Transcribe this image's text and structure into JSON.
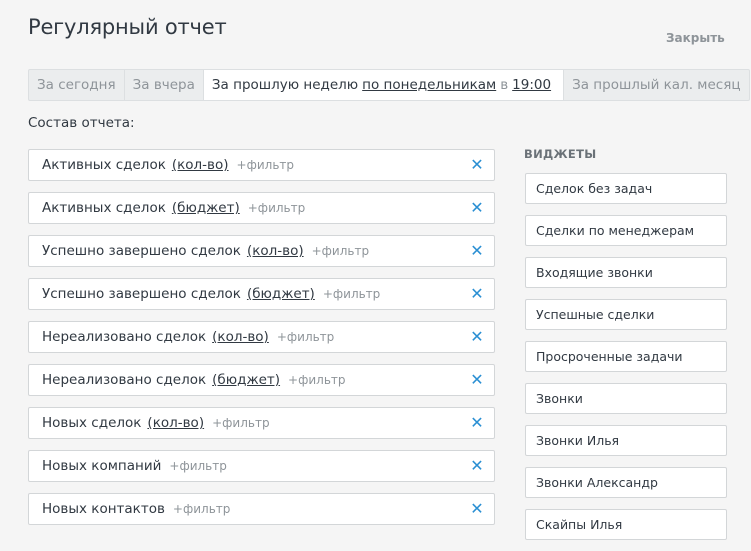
{
  "header": {
    "title": "Регулярный отчет",
    "close_label": "Закрыть"
  },
  "tabs": {
    "today": "За сегодня",
    "yesterday": "За вчера",
    "week": {
      "label": "За прошлую неделю",
      "day": "по понедельникам",
      "at": "в",
      "time": "19:00"
    },
    "month": "За прошлый кал. месяц"
  },
  "section_label": "Состав отчета:",
  "filter_label": "+фильтр",
  "items": [
    {
      "name": "Активных сделок",
      "unit": "(кол-во)"
    },
    {
      "name": "Активных сделок",
      "unit": "(бюджет)"
    },
    {
      "name": "Успешно завершено сделок",
      "unit": "(кол-во)"
    },
    {
      "name": "Успешно завершено сделок",
      "unit": "(бюджет)"
    },
    {
      "name": "Нереализовано сделок",
      "unit": "(кол-во)"
    },
    {
      "name": "Нереализовано сделок",
      "unit": "(бюджет)"
    },
    {
      "name": "Новых сделок",
      "unit": "(кол-во)"
    },
    {
      "name": "Новых компаний",
      "unit": ""
    },
    {
      "name": "Новых контактов",
      "unit": ""
    }
  ],
  "widgets_title": "ВИДЖЕТЫ",
  "widgets": [
    "Сделок без задач",
    "Сделки по менеджерам",
    "Входящие звонки",
    "Успешные сделки",
    "Просроченные задачи",
    "Звонки",
    "Звонки Илья",
    "Звонки Александр",
    "Скайпы Илья"
  ],
  "icons": {
    "remove": "close-x-icon"
  },
  "colors": {
    "accent": "#2a8fd3",
    "text": "#313942",
    "muted": "#8e9499"
  }
}
